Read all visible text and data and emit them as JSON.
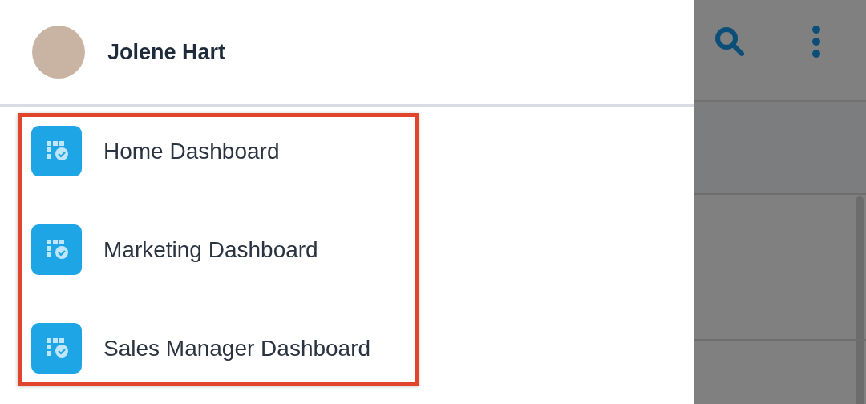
{
  "drawer": {
    "user": {
      "name": "Jolene Hart"
    },
    "items": [
      {
        "label": "Home Dashboard"
      },
      {
        "label": "Marketing Dashboard"
      },
      {
        "label": "Sales Manager Dashboard"
      }
    ]
  }
}
